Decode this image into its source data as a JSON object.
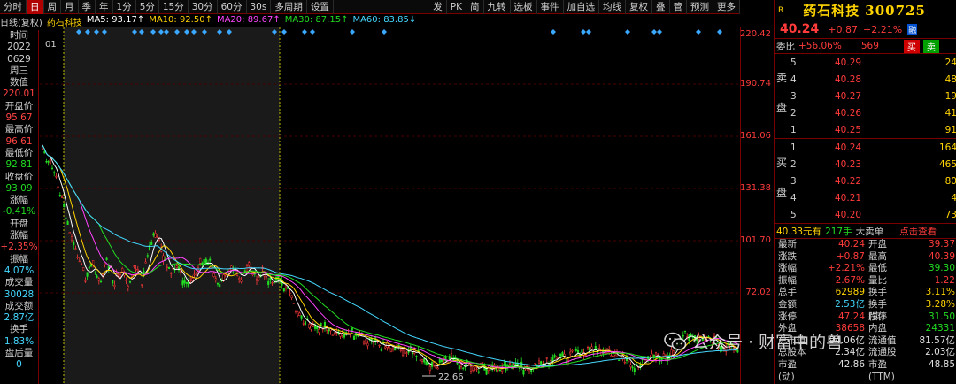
{
  "toolbar": {
    "items": [
      "分时",
      "日",
      "周",
      "月",
      "季",
      "年",
      "1分",
      "5分",
      "15分",
      "30分",
      "60分",
      "30s",
      "多周期",
      "设置"
    ],
    "active_index": 1,
    "right_items": [
      "发",
      "PK",
      "简",
      "九转",
      "选板",
      "事件",
      "加自选",
      "均线",
      "复权",
      "叠",
      "管",
      "预测",
      "更多"
    ]
  },
  "infobar": {
    "period": "日线(复权)",
    "stock": "药石科技",
    "ma5": "MA5: 93.17↑",
    "ma10": "MA10: 92.50↑",
    "ma20": "MA20: 89.67↑",
    "ma30": "MA30: 87.15↑",
    "ma60": "MA60: 83.85↓"
  },
  "chart_marker": "01",
  "left_panel": {
    "time_label": "时间",
    "year": "2022",
    "date": "0629",
    "weekday": "周三",
    "value_label": "数值",
    "value": "220.01",
    "open_label": "开盘价",
    "open": "95.67",
    "high_label": "最高价",
    "high": "96.61",
    "low_label": "最低价",
    "low": "92.81",
    "close_label": "收盘价",
    "close": "93.09",
    "change_label": "涨幅",
    "change": "-0.41%",
    "open_change_label1": "开盘",
    "open_change_label2": "涨幅",
    "open_change": "+2.35%",
    "amplitude_label": "振幅",
    "amplitude": "4.07%",
    "volume_label": "成交量",
    "volume": "30028",
    "turnover_label": "成交额",
    "turnover": "2.87亿",
    "rate_label": "换手",
    "rate": "1.83%",
    "after_label": "盘后量",
    "after": "0"
  },
  "y_axis": {
    "labels": [
      "220.42",
      "190.74",
      "161.06",
      "131.38",
      "101.70",
      "72.02"
    ],
    "low_marker": "22.66"
  },
  "colors": {
    "up": "#ff3b3b",
    "down": "#22dd22",
    "accent": "#ffd400",
    "border": "#7a0000",
    "ma5": "#ffffff",
    "ma10": "#ffd400",
    "ma20": "#ff44ff",
    "ma30": "#22dd22",
    "ma60": "#44d8ff"
  },
  "quote": {
    "r_badge": "R",
    "name": "药石科技",
    "code": "300725",
    "price": "40.24",
    "change": "+0.87",
    "change_pct": "+2.21%",
    "rong": "融",
    "weibi_label": "委比",
    "weibi": "+56.06%",
    "weicha": "569",
    "buy_btn": "买",
    "sell_btn": "卖",
    "sell_label": [
      "卖",
      "盘"
    ],
    "buy_label": [
      "买",
      "盘"
    ],
    "asks": [
      {
        "level": "5",
        "price": "40.29",
        "vol": "24"
      },
      {
        "level": "4",
        "price": "40.28",
        "vol": "48"
      },
      {
        "level": "3",
        "price": "40.27",
        "vol": "19"
      },
      {
        "level": "2",
        "price": "40.26",
        "vol": "41"
      },
      {
        "level": "1",
        "price": "40.25",
        "vol": "91"
      }
    ],
    "bids": [
      {
        "level": "1",
        "price": "40.24",
        "vol": "164"
      },
      {
        "level": "2",
        "price": "40.23",
        "vol": "465"
      },
      {
        "level": "3",
        "price": "40.22",
        "vol": "80"
      },
      {
        "level": "4",
        "price": "40.21",
        "vol": "4"
      },
      {
        "level": "5",
        "price": "40.20",
        "vol": "73"
      }
    ],
    "trade_amount": "40.33元有",
    "trade_hands": "217手",
    "trade_type": "大卖单",
    "trade_link": "点击查看",
    "rows": [
      {
        "l": "最新",
        "v1": "40.24",
        "c1": "red",
        "r": "开盘",
        "v2": "39.37",
        "c2": "red"
      },
      {
        "l": "涨跌",
        "v1": "+0.87",
        "c1": "red",
        "r": "最高",
        "v2": "40.39",
        "c2": "red"
      },
      {
        "l": "涨幅",
        "v1": "+2.21%",
        "c1": "red",
        "r": "最低",
        "v2": "39.30",
        "c2": "green"
      },
      {
        "l": "振幅",
        "v1": "2.67%",
        "c1": "red",
        "r": "量比",
        "v2": "1.22",
        "c2": "red"
      },
      {
        "l": "总手",
        "v1": "62989",
        "c1": "yellow",
        "r": "换手",
        "v2": "3.11%",
        "c2": "yellow"
      },
      {
        "l": "金额",
        "v1": "2.53亿",
        "c1": "cyan",
        "r": "换手(实)",
        "v2": "3.28%",
        "c2": "yellow"
      },
      {
        "l": "涨停",
        "v1": "47.24",
        "c1": "red",
        "r": "跌停",
        "v2": "31.50",
        "c2": "green"
      },
      {
        "l": "外盘",
        "v1": "38658",
        "c1": "red",
        "r": "内盘",
        "v2": "24331",
        "c2": "green"
      },
      {
        "l": "总市值",
        "v1": "94.06亿",
        "c1": "white",
        "r": "流通值",
        "v2": "81.57亿",
        "c2": "white"
      },
      {
        "l": "总股本",
        "v1": "2.34亿",
        "c1": "white",
        "r": "流通股",
        "v2": "2.03亿",
        "c2": "white"
      },
      {
        "l": "市盈(动)",
        "v1": "42.86",
        "c1": "white",
        "r": "市盈(TTM)",
        "v2": "48.85",
        "c2": "white"
      }
    ]
  },
  "watermark": {
    "text": "公众号 · 财富中的兽"
  }
}
